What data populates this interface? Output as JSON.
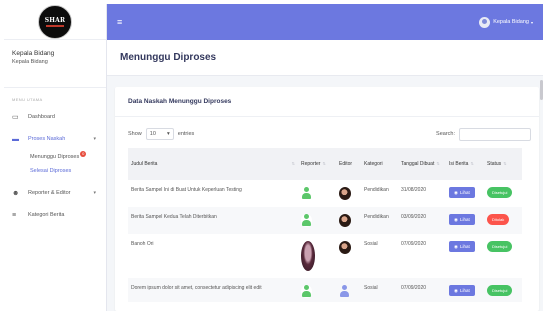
{
  "sidebar": {
    "logo_text": "SHAR",
    "user_name": "Kepala Bidang",
    "user_role": "Kepala Bidang",
    "menu_heading": "MENU UTAMA",
    "items": [
      {
        "label": "Dashboard",
        "icon": "monitor-icon"
      },
      {
        "label": "Proses Naskah",
        "icon": "file-icon",
        "mark": "+"
      },
      {
        "label": "Reporter & Editor",
        "icon": "users-icon",
        "mark": "+"
      },
      {
        "label": "Kategori Berita",
        "icon": "list-icon"
      }
    ],
    "sub_items": [
      {
        "label": "Menunggu Diproses",
        "badge": "0"
      },
      {
        "label": "Selesai Diproses"
      }
    ]
  },
  "navbar": {
    "menu_icon": "≡",
    "user_label": "Kepala Bidang",
    "caret": "▾"
  },
  "main": {
    "page_title": "Menunggu Diproses",
    "card_title": "Data Naskah Menunggu Diproses",
    "show_label": "Show",
    "entries_value": "10",
    "entries_label": "entries",
    "search_label": "Search:",
    "columns": [
      "Judul Berita",
      "Reporter",
      "Editor",
      "Kategori",
      "Tanggal Dibuat",
      "Isi Berita",
      "Status"
    ],
    "rows": [
      {
        "judul": "Berita Sampel Ini di Buat Untuk Keperluan Testing",
        "kategori": "Pendidikan",
        "tanggal": "31/08/2020",
        "isi": "Lihat",
        "status": "Disetujui",
        "status_color": "#47c363"
      },
      {
        "judul": "Berita Sampel Kedua Telah Diterbitkan",
        "kategori": "Pendidikan",
        "tanggal": "03/09/2020",
        "isi": "Lihat",
        "status": "Ditolak",
        "status_color": "#fc544b"
      },
      {
        "judul": "Banoh Ori",
        "kategori": "Sosial",
        "tanggal": "07/09/2020",
        "isi": "Lihat",
        "status": "Disetujui",
        "status_color": "#47c363"
      },
      {
        "judul": "Dorem ipsum dolor sit amet, consectetur adipiscing elit edit",
        "kategori": "Sosial",
        "tanggal": "07/09/2020",
        "isi": "Lihat",
        "status": "Disetujui",
        "status_color": "#47c363"
      }
    ]
  },
  "colors": {
    "primary": "#6c78e0",
    "success": "#47c363",
    "danger": "#fc544b"
  }
}
